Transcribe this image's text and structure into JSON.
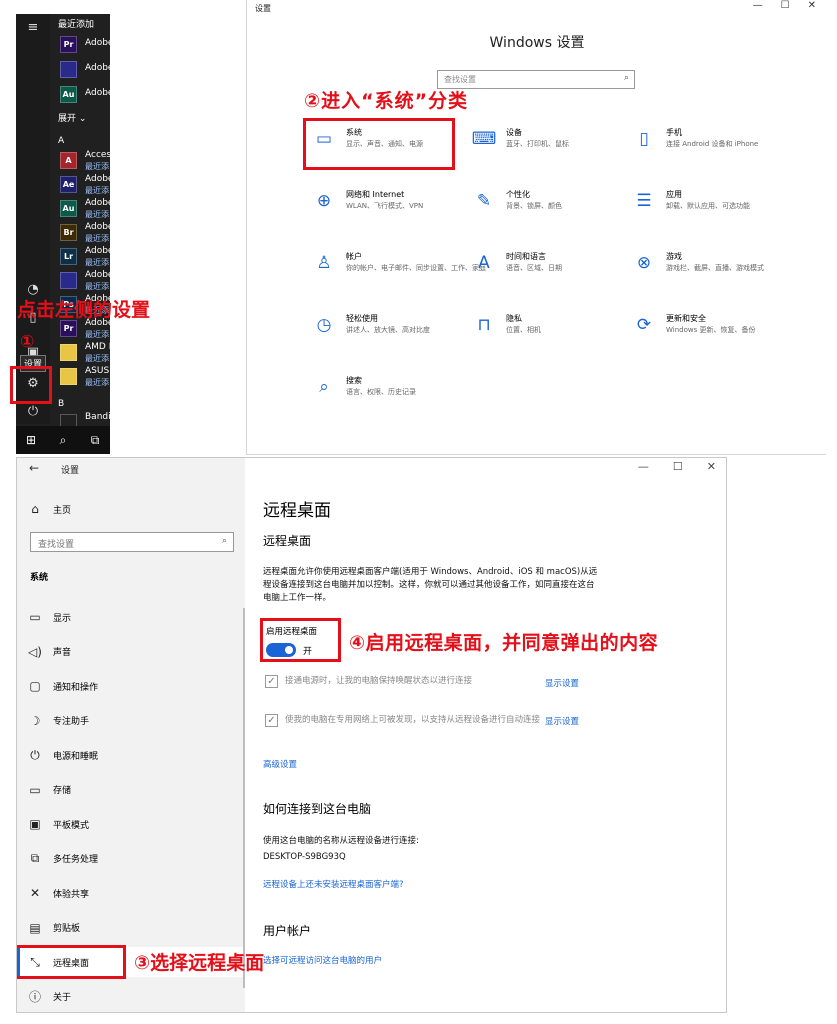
{
  "start_menu": {
    "recent_header": "最近添加",
    "expand_label": "展开 ⌄",
    "letter_a": "A",
    "letter_b": "B",
    "recent_apps": [
      {
        "tile": "Pr",
        "name": "Adobe",
        "color": "#2a0f5c"
      },
      {
        "tile": "",
        "name": "Adobe",
        "color": "#2a2a8a"
      },
      {
        "tile": "Au",
        "name": "Adobe",
        "color": "#0e5a4a"
      }
    ],
    "apps": [
      {
        "tile": "A",
        "name": "Access",
        "sub": "最近添",
        "color": "#a4262c"
      },
      {
        "tile": "Ae",
        "name": "Adobe",
        "sub": "最近添",
        "color": "#1f1f6b"
      },
      {
        "tile": "Au",
        "name": "Adobe",
        "sub": "最近添",
        "color": "#0e5a4a"
      },
      {
        "tile": "Br",
        "name": "Adobe",
        "sub": "最近添",
        "color": "#3d2b05"
      },
      {
        "tile": "Lr",
        "name": "Adobe",
        "sub": "最近添",
        "color": "#0d3048"
      },
      {
        "tile": "",
        "name": "Adobe",
        "sub": "最近添",
        "color": "#2a2a8a"
      },
      {
        "tile": "Ps",
        "name": "Adobe",
        "sub": "最近添",
        "color": "#0a2a4d"
      },
      {
        "tile": "Pr",
        "name": "Adobe",
        "sub": "最近添",
        "color": "#2a0f5c"
      },
      {
        "tile": "",
        "name": "AMD R",
        "sub": "最近添",
        "color": "#e8c544"
      },
      {
        "tile": "",
        "name": "ASUS",
        "sub": "最近添",
        "color": "#e8c544"
      },
      {
        "tile": "",
        "name": "Bandiz",
        "sub": "",
        "color": "#202020"
      }
    ],
    "settings_tooltip": "设置"
  },
  "settings_home": {
    "window_title": "设置",
    "heading": "Windows 设置",
    "search_placeholder": "查找设置",
    "categories": [
      {
        "title": "系统",
        "desc": "显示、声音、通知、电源",
        "icon": "laptop-icon"
      },
      {
        "title": "设备",
        "desc": "蓝牙、打印机、鼠标",
        "icon": "keyboard-icon"
      },
      {
        "title": "手机",
        "desc": "连接 Android 设备和 iPhone",
        "icon": "phone-icon"
      },
      {
        "title": "网络和 Internet",
        "desc": "WLAN、飞行模式、VPN",
        "icon": "globe-icon"
      },
      {
        "title": "个性化",
        "desc": "背景、锁屏、颜色",
        "icon": "paint-icon"
      },
      {
        "title": "应用",
        "desc": "卸载、默认应用、可选功能",
        "icon": "apps-list-icon"
      },
      {
        "title": "帐户",
        "desc": "你的帐户、电子邮件、同步设置、工作、家庭",
        "icon": "person-icon"
      },
      {
        "title": "时间和语言",
        "desc": "语音、区域、日期",
        "icon": "language-icon"
      },
      {
        "title": "游戏",
        "desc": "游戏栏、截屏、直播、游戏模式",
        "icon": "xbox-icon"
      },
      {
        "title": "轻松使用",
        "desc": "讲述人、放大镜、高对比度",
        "icon": "ease-of-access-icon"
      },
      {
        "title": "隐私",
        "desc": "位置、相机",
        "icon": "lock-icon"
      },
      {
        "title": "更新和安全",
        "desc": "Windows 更新、恢复、备份",
        "icon": "sync-icon"
      },
      {
        "title": "搜索",
        "desc": "语言、权限、历史记录",
        "icon": "search-icon"
      }
    ]
  },
  "remote_window": {
    "window_title": "设置",
    "home_label": "主页",
    "search_placeholder": "查找设置",
    "section_label": "系统",
    "nav_items": [
      {
        "label": "显示",
        "icon": "monitor-icon"
      },
      {
        "label": "声音",
        "icon": "speaker-icon"
      },
      {
        "label": "通知和操作",
        "icon": "notification-icon"
      },
      {
        "label": "专注助手",
        "icon": "moon-icon"
      },
      {
        "label": "电源和睡眠",
        "icon": "power-icon"
      },
      {
        "label": "存储",
        "icon": "storage-icon"
      },
      {
        "label": "平板模式",
        "icon": "tablet-icon"
      },
      {
        "label": "多任务处理",
        "icon": "multitask-icon"
      },
      {
        "label": "体验共享",
        "icon": "share-icon"
      },
      {
        "label": "剪贴板",
        "icon": "clipboard-icon"
      },
      {
        "label": "远程桌面",
        "icon": "remote-desktop-icon"
      },
      {
        "label": "关于",
        "icon": "info-icon"
      }
    ],
    "page_title": "远程桌面",
    "sub_title": "远程桌面",
    "description": "远程桌面允许你使用远程桌面客户端(适用于 Windows、Android、iOS 和 macOS)从远程设备连接到这台电脑并加以控制。这样，你就可以通过其他设备工作，如同直接在这台电脑上工作一样。",
    "enable_label": "启用远程桌面",
    "toggle_state": "开",
    "option1": "接通电源时，让我的电脑保持唤醒状态以进行连接",
    "option2": "使我的电脑在专用网络上可被发现，以支持从远程设备进行自动连接",
    "show_settings": "显示设置",
    "advanced_settings": "高级设置",
    "howto_title": "如何连接到这台电脑",
    "howto_text": "使用这台电脑的名称从远程设备进行连接:",
    "pc_name": "DESKTOP-S9BG93Q",
    "no_client_link": "远程设备上还未安装远程桌面客户端?",
    "users_title": "用户帐户",
    "users_link": "选择可远程访问这台电脑的用户"
  },
  "annotations": {
    "step1": "点击左侧的设置",
    "step1_num": "①",
    "step2": "②进入“系统”分类",
    "step3": "③选择远程桌面",
    "step4": "④启用远程桌面，并同意弹出的内容"
  }
}
